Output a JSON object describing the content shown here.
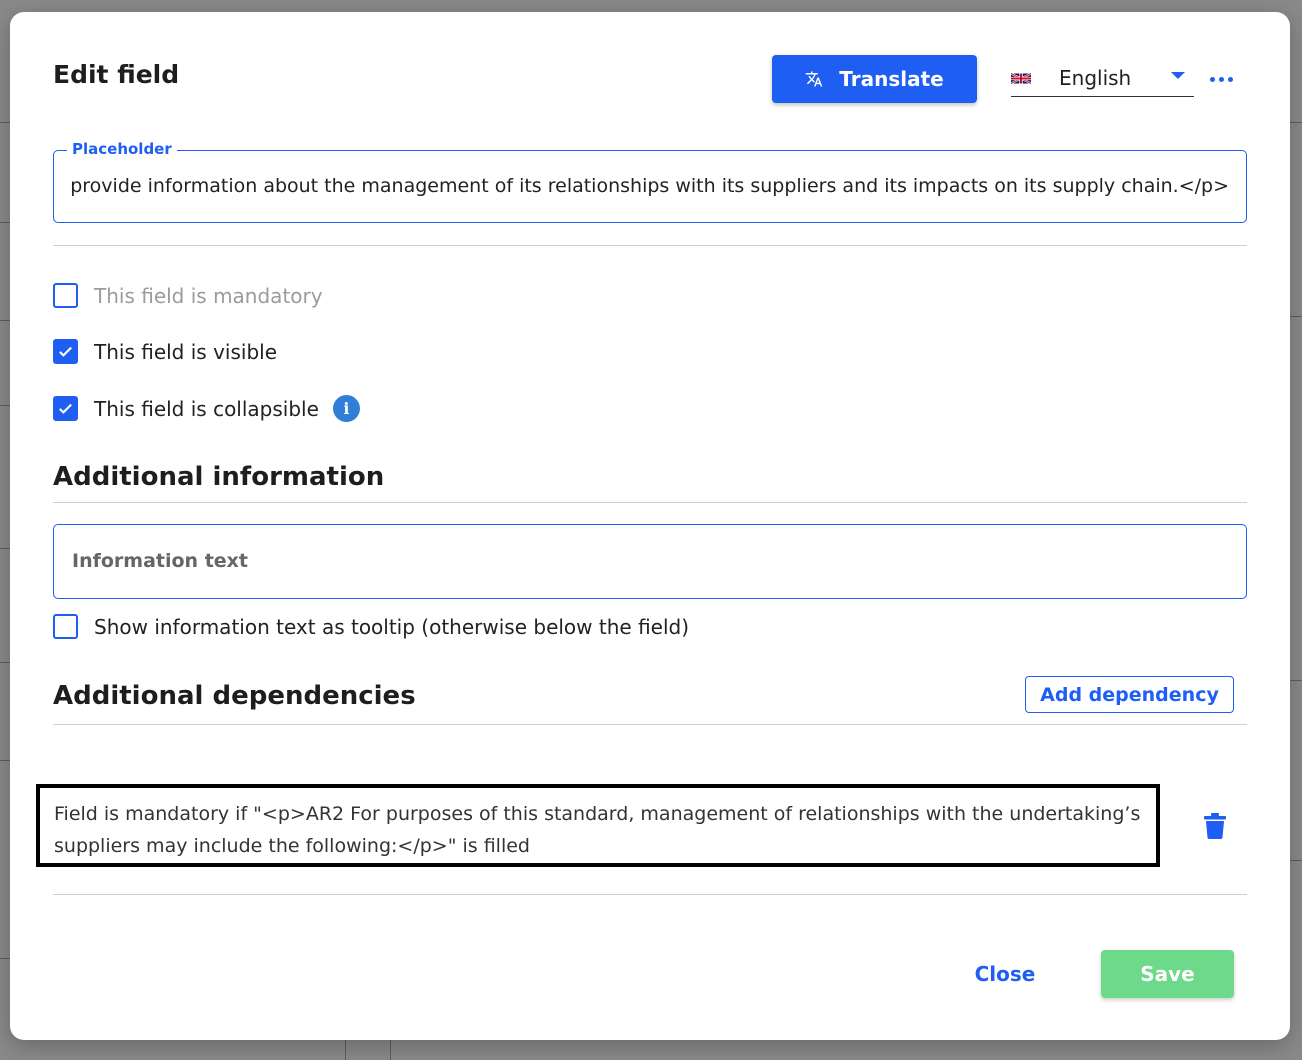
{
  "dialog": {
    "title": "Edit field",
    "translate_label": "Translate",
    "language": "English",
    "accent_color": "#1f5ef2",
    "icons": {
      "translate": "translate-icon",
      "flag": "uk-flag-icon",
      "more": "more-horizontal-icon",
      "info": "info-icon",
      "delete": "trash-icon"
    }
  },
  "placeholder_field": {
    "label": "Placeholder",
    "value": "l provide information about the management of its relationships with its suppliers and its impacts on its supply chain.</p>"
  },
  "options": {
    "mandatory": {
      "label": "This field is mandatory",
      "checked": false,
      "disabled": true
    },
    "visible": {
      "label": "This field is visible",
      "checked": true
    },
    "collapsible": {
      "label": "This field is collapsible",
      "checked": true
    }
  },
  "additional_information": {
    "title": "Additional information",
    "input_placeholder": "Information text",
    "tooltip_option": {
      "label": "Show information text as tooltip (otherwise below the field)",
      "checked": false
    }
  },
  "additional_dependencies": {
    "title": "Additional dependencies",
    "add_label": "Add dependency",
    "items": [
      {
        "text": "Field is mandatory if \"<p>AR2 For purposes of this standard, management of relationships with the undertaking’s suppliers may include the following:</p>\" is filled"
      }
    ]
  },
  "footer": {
    "close_label": "Close",
    "save_label": "Save",
    "save_color": "#6cd98b"
  }
}
